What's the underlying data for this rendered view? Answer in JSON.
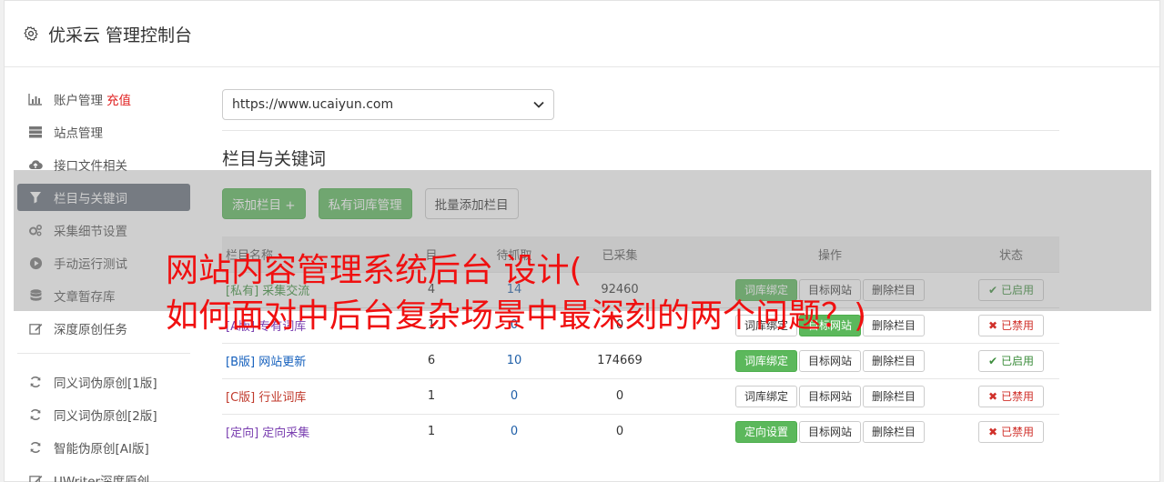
{
  "app": {
    "title": "优采云 管理控制台"
  },
  "sidebar": {
    "items": [
      {
        "label": "账户管理",
        "badge": "充值",
        "icon": "bar-chart-icon"
      },
      {
        "label": "站点管理",
        "icon": "server-icon"
      },
      {
        "label": "接口文件相关",
        "icon": "cloud-upload-icon"
      },
      {
        "label": "栏目与关键词",
        "icon": "filter-icon",
        "active": true
      },
      {
        "label": "采集细节设置",
        "icon": "gears-icon"
      },
      {
        "label": "手动运行测试",
        "icon": "play-circle-icon"
      },
      {
        "label": "文章暂存库",
        "icon": "database-icon"
      },
      {
        "label": "深度原创任务",
        "icon": "edit-icon"
      }
    ],
    "items2": [
      {
        "label": "同义词伪原创[1版]",
        "icon": "refresh-icon"
      },
      {
        "label": "同义词伪原创[2版]",
        "icon": "refresh-icon"
      },
      {
        "label": "智能伪原创[AI版]",
        "icon": "refresh-icon"
      },
      {
        "label": "UWriter深度原创",
        "icon": "edit-icon"
      }
    ]
  },
  "main": {
    "site_select": "https://www.ucaiyun.com",
    "section_title": "栏目与关键词",
    "buttons": {
      "add": "添加栏目 +",
      "private_lib": "私有词库管理",
      "batch_add": "批量添加栏目"
    },
    "table": {
      "headers": {
        "name": "栏目名称",
        "col2": "目",
        "col3": "待抓取",
        "col4": "已采集",
        "ops": "操作",
        "status": "状态"
      },
      "rows": [
        {
          "tag": "[私有]",
          "name": "采集交流",
          "c2": "4",
          "c3": "14",
          "c4": "92460",
          "op1": "词库绑定",
          "op2": "目标网站",
          "op3": "删除栏目",
          "status": "已启用"
        },
        {
          "tag": "[A版]",
          "name": "专有词库",
          "c2": "1",
          "c3": "0",
          "c4": "0",
          "op1": "词库绑定",
          "op2": "目标网站",
          "op3": "删除栏目",
          "status": "已禁用"
        },
        {
          "tag": "[B版]",
          "name": "网站更新",
          "c2": "6",
          "c3": "10",
          "c4": "174669",
          "op1": "词库绑定",
          "op2": "目标网站",
          "op3": "删除栏目",
          "status": "已启用"
        },
        {
          "tag": "[C版]",
          "name": "行业词库",
          "c2": "1",
          "c3": "0",
          "c4": "0",
          "op1": "词库绑定",
          "op2": "目标网站",
          "op3": "删除栏目",
          "status": "已禁用"
        },
        {
          "tag": "[定向]",
          "name": "定向采集",
          "c2": "1",
          "c3": "0",
          "c4": "0",
          "op1": "定向设置",
          "op2": "目标网站",
          "op3": "删除栏目",
          "status": "已禁用"
        }
      ]
    }
  },
  "overlay": {
    "line1": "网站内容管理系统后台 设计(",
    "line2": "如何面对中后台复杂场景中最深刻的两个问题？)"
  },
  "colors": {
    "accent_green": "#5cb85c",
    "active_nav": "#666f7a",
    "headline_red": "#f01010"
  }
}
